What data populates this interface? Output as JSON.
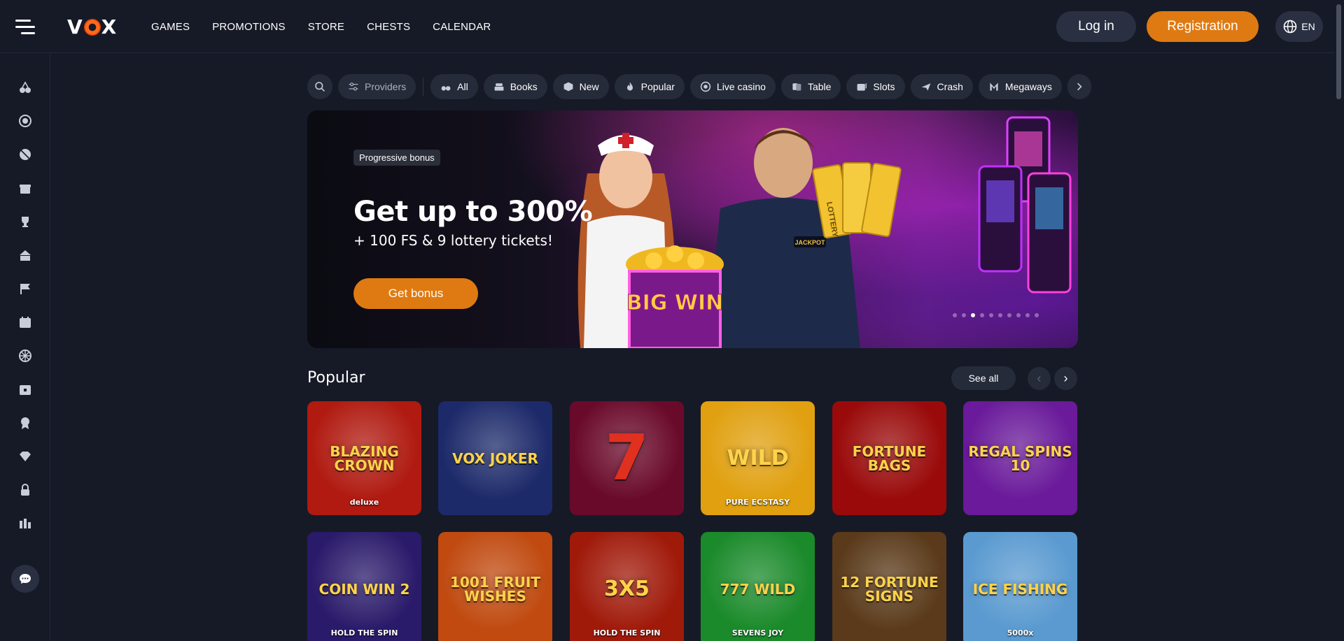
{
  "header": {
    "logo": "VOX",
    "nav": [
      "GAMES",
      "PROMOTIONS",
      "STORE",
      "CHESTS",
      "CALENDAR"
    ],
    "login_label": "Log in",
    "registration_label": "Registration",
    "lang": "EN"
  },
  "sidebar": {
    "icons": [
      "cherry-icon",
      "target-icon",
      "ball-icon",
      "gift-icon",
      "trophy-icon",
      "cash-icon",
      "flags-icon",
      "calendar-icon",
      "wheel-icon",
      "chest-icon",
      "badge-icon",
      "diamond-icon",
      "lock-icon",
      "stats-icon"
    ]
  },
  "filters": {
    "providers_label": "Providers",
    "categories": [
      "All",
      "Books",
      "New",
      "Popular",
      "Live casino",
      "Table",
      "Slots",
      "Crash",
      "Megaways"
    ]
  },
  "banner": {
    "tag": "Progressive bonus",
    "title": "Get up to 300%",
    "subtitle": "+ 100 FS & 9 lottery tickets!",
    "cta": "Get bonus",
    "art_text": {
      "box": "BIG WIN",
      "tickets": "LOTTERY",
      "badge": "JACKPOT"
    },
    "slides_total": 10,
    "active_slide": 3
  },
  "popular": {
    "title": "Popular",
    "see_all": "See all",
    "games_row1": [
      {
        "name": "BLAZING CROWN",
        "sub": "deluxe",
        "bg": "#b01a10"
      },
      {
        "name": "VOX JOKER",
        "sub": "",
        "bg": "#1d2a6a"
      },
      {
        "name": "7",
        "sub": "",
        "bg": "#6a0a2a"
      },
      {
        "name": "WILD",
        "sub": "PURE ECSTASY",
        "bg": "#e0a010"
      },
      {
        "name": "FORTUNE BAGS",
        "sub": "",
        "bg": "#9a0a0a"
      },
      {
        "name": "REGAL SPINS 10",
        "sub": "",
        "bg": "#6a1a9a"
      }
    ],
    "games_row2": [
      {
        "name": "COIN WIN 2",
        "sub": "HOLD THE SPIN",
        "bg": "#2a1a6a"
      },
      {
        "name": "1001 FRUIT WISHES",
        "sub": "",
        "bg": "#c04a10"
      },
      {
        "name": "3X5",
        "sub": "HOLD THE SPIN",
        "bg": "#a01a0a"
      },
      {
        "name": "777 WILD",
        "sub": "SEVENS JOY",
        "bg": "#1a8a2a"
      },
      {
        "name": "12 FORTUNE SIGNS",
        "sub": "",
        "bg": "#5a3a1a"
      },
      {
        "name": "ICE FISHING",
        "sub": "5000x",
        "bg": "#5a9ad0"
      }
    ]
  }
}
